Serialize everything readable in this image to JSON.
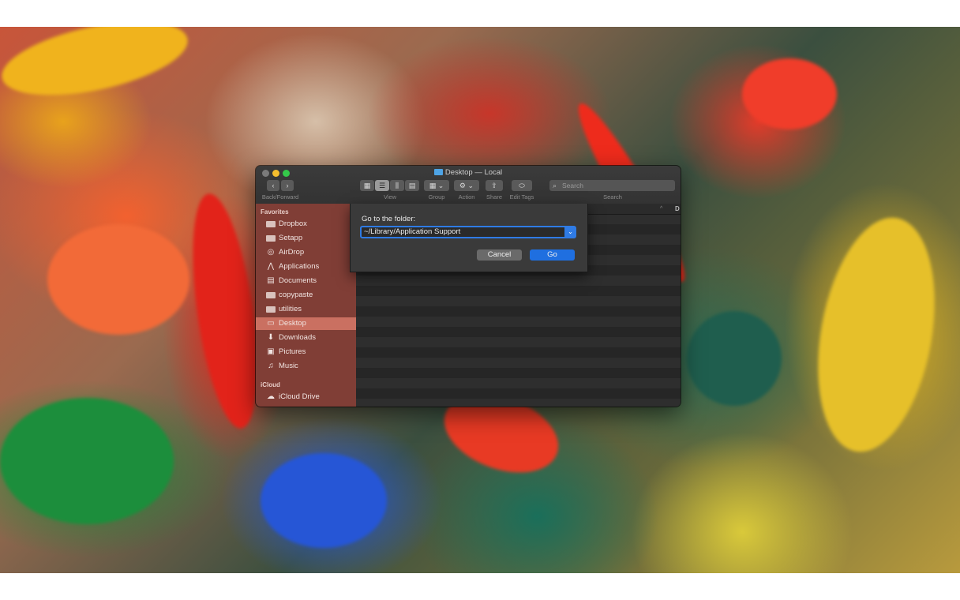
{
  "window": {
    "title": "Desktop — Local"
  },
  "toolbar": {
    "back_forward_label": "Back/Forward",
    "view_label": "View",
    "group_label": "Group",
    "action_label": "Action",
    "share_label": "Share",
    "edit_tags_label": "Edit Tags",
    "search_label": "Search",
    "search_placeholder": "Search"
  },
  "sidebar": {
    "favorites_heading": "Favorites",
    "favorites": [
      {
        "label": "Dropbox",
        "icon": "folder-icon"
      },
      {
        "label": "Setapp",
        "icon": "folder-icon"
      },
      {
        "label": "AirDrop",
        "icon": "airdrop-icon"
      },
      {
        "label": "Applications",
        "icon": "applications-icon"
      },
      {
        "label": "Documents",
        "icon": "document-icon"
      },
      {
        "label": "copypaste",
        "icon": "folder-icon"
      },
      {
        "label": "utilities",
        "icon": "folder-icon"
      },
      {
        "label": "Desktop",
        "icon": "desktop-icon",
        "selected": true
      },
      {
        "label": "Downloads",
        "icon": "download-icon"
      },
      {
        "label": "Pictures",
        "icon": "pictures-icon"
      },
      {
        "label": "Music",
        "icon": "music-icon"
      }
    ],
    "icloud_heading": "iCloud",
    "icloud": [
      {
        "label": "iCloud Drive",
        "icon": "cloud-icon"
      }
    ]
  },
  "list": {
    "column_header_partial": "D"
  },
  "goto_sheet": {
    "title": "Go to the folder:",
    "path_value": "~/Library/Application Support",
    "cancel_label": "Cancel",
    "go_label": "Go"
  },
  "colors": {
    "accent_blue": "#2f7be5",
    "sidebar_tint": "#96463c",
    "selection": "#cd7364"
  }
}
